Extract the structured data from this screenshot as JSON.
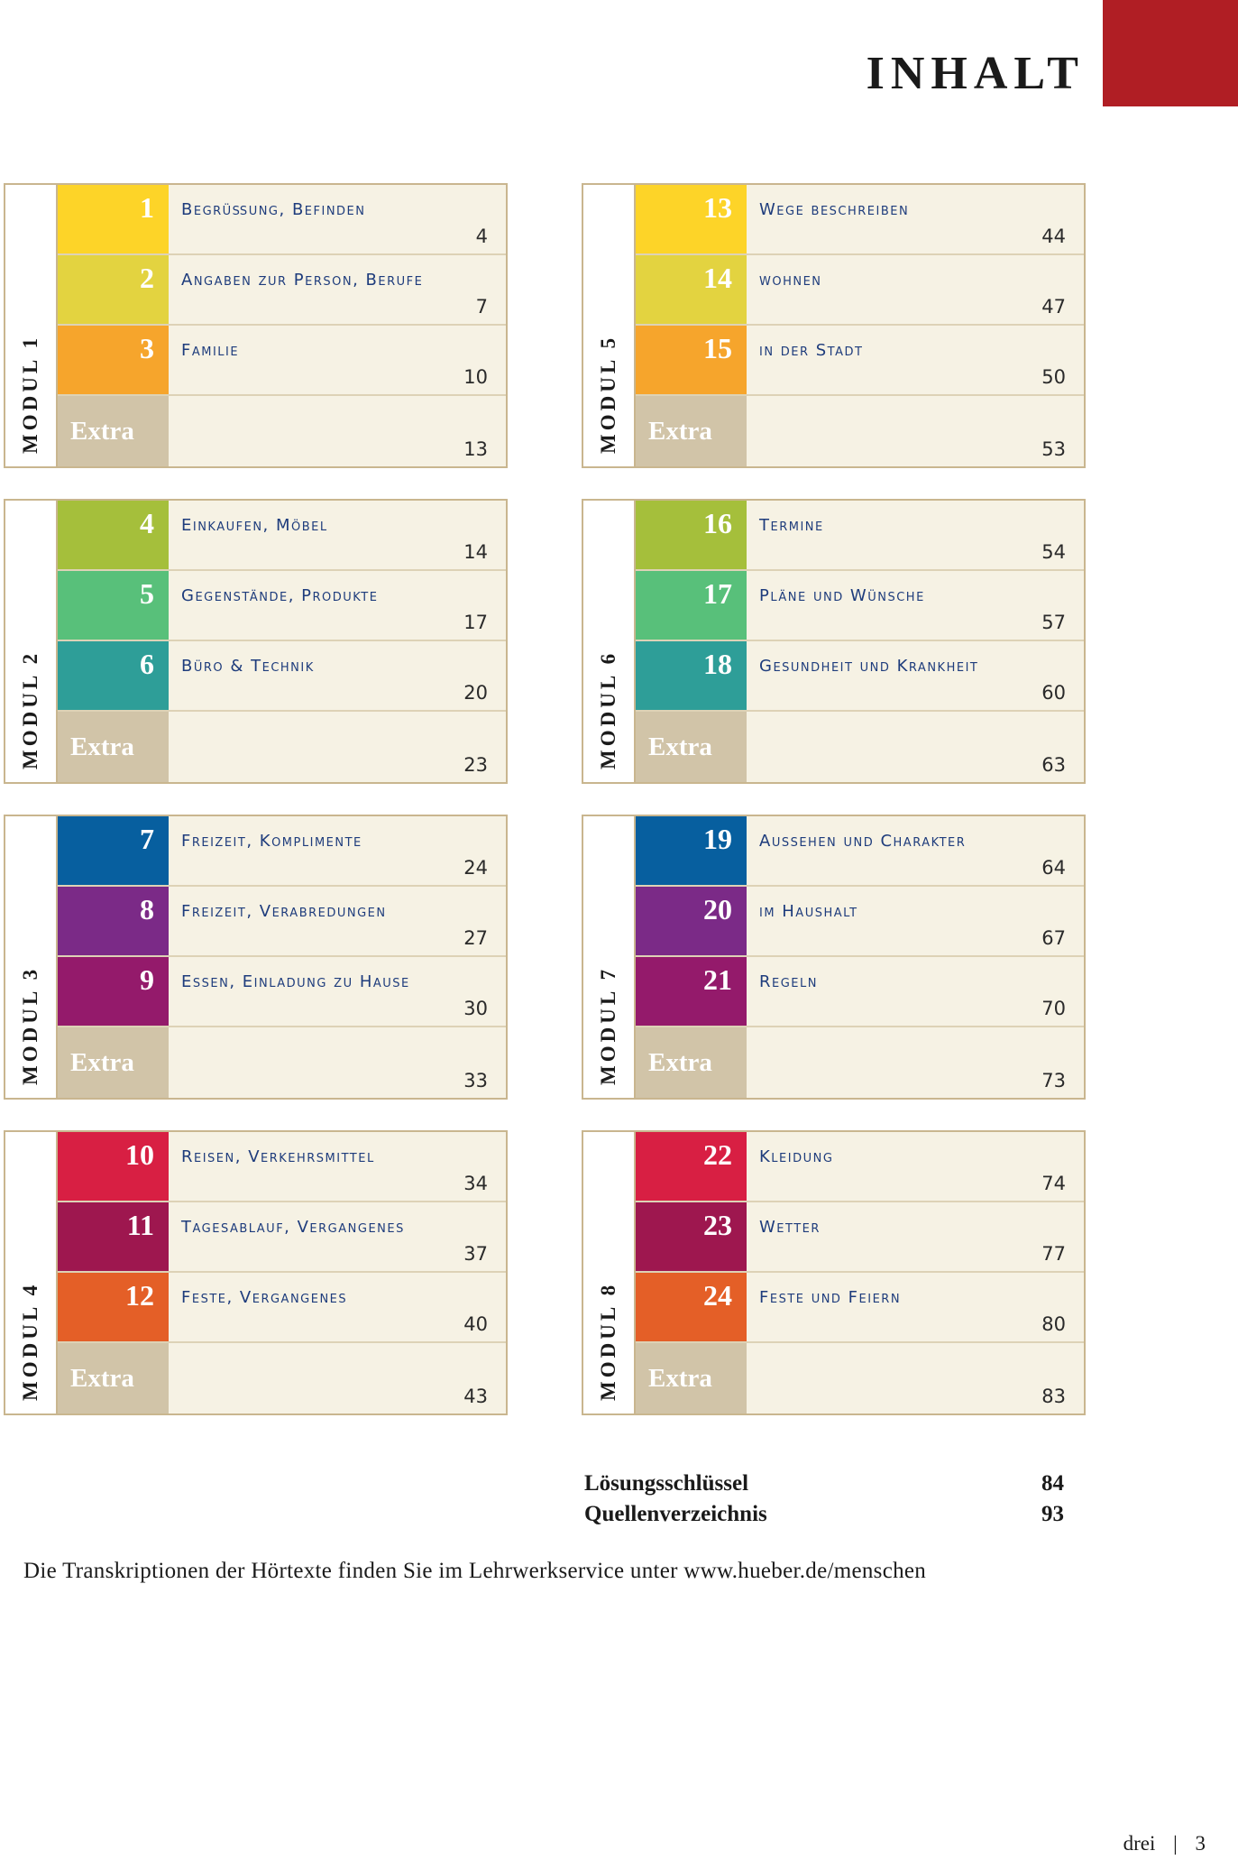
{
  "header": {
    "title": "INHALT",
    "accent_color": "#b01e24"
  },
  "colors": {
    "yellow": "#fdd428",
    "yellow2": "#e3d340",
    "orange": "#f6a52c",
    "lime": "#a5bf3b",
    "green": "#58c07a",
    "teal": "#2e9e98",
    "blue": "#075f9f",
    "purple": "#7b2a87",
    "plum": "#941a6b",
    "red": "#d81f43",
    "wine": "#9e174f",
    "deeporange": "#e45f27",
    "extra": "#d1c4a8",
    "border": "#c9b68f",
    "cell_bg": "#f6f2e4",
    "topic_text": "#1e3c7c"
  },
  "modules": [
    {
      "label": "MODUL 1",
      "rows": [
        {
          "num": "1",
          "topic": "Begrüßung, Befinden",
          "page": "4"
        },
        {
          "num": "2",
          "topic": "Angaben zur Person, Berufe",
          "page": "7"
        },
        {
          "num": "3",
          "topic": "Familie",
          "page": "10"
        },
        {
          "num": "Extra",
          "topic": "",
          "page": "13"
        }
      ]
    },
    {
      "label": "MODUL 2",
      "rows": [
        {
          "num": "4",
          "topic": "Einkaufen, Möbel",
          "page": "14"
        },
        {
          "num": "5",
          "topic": "Gegenstände, Produkte",
          "page": "17"
        },
        {
          "num": "6",
          "topic": "Büro & Technik",
          "page": "20"
        },
        {
          "num": "Extra",
          "topic": "",
          "page": "23"
        }
      ]
    },
    {
      "label": "MODUL 3",
      "rows": [
        {
          "num": "7",
          "topic": "Freizeit, Komplimente",
          "page": "24"
        },
        {
          "num": "8",
          "topic": "Freizeit, Verabredungen",
          "page": "27"
        },
        {
          "num": "9",
          "topic": "Essen, Einladung zu Hause",
          "page": "30"
        },
        {
          "num": "Extra",
          "topic": "",
          "page": "33"
        }
      ]
    },
    {
      "label": "MODUL 4",
      "rows": [
        {
          "num": "10",
          "topic": "Reisen, Verkehrsmittel",
          "page": "34"
        },
        {
          "num": "11",
          "topic": "Tagesablauf, Vergangenes",
          "page": "37"
        },
        {
          "num": "12",
          "topic": "Feste, Vergangenes",
          "page": "40"
        },
        {
          "num": "Extra",
          "topic": "",
          "page": "43"
        }
      ]
    },
    {
      "label": "MODUL 5",
      "rows": [
        {
          "num": "13",
          "topic": "Wege beschreiben",
          "page": "44"
        },
        {
          "num": "14",
          "topic": "wohnen",
          "page": "47"
        },
        {
          "num": "15",
          "topic": "in der Stadt",
          "page": "50"
        },
        {
          "num": "Extra",
          "topic": "",
          "page": "53"
        }
      ]
    },
    {
      "label": "MODUL 6",
      "rows": [
        {
          "num": "16",
          "topic": "Termine",
          "page": "54"
        },
        {
          "num": "17",
          "topic": "Pläne und Wünsche",
          "page": "57"
        },
        {
          "num": "18",
          "topic": "Gesundheit und Krankheit",
          "page": "60"
        },
        {
          "num": "Extra",
          "topic": "",
          "page": "63"
        }
      ]
    },
    {
      "label": "MODUL 7",
      "rows": [
        {
          "num": "19",
          "topic": "Aussehen und Charakter",
          "page": "64"
        },
        {
          "num": "20",
          "topic": "im Haushalt",
          "page": "67"
        },
        {
          "num": "21",
          "topic": "Regeln",
          "page": "70"
        },
        {
          "num": "Extra",
          "topic": "",
          "page": "73"
        }
      ]
    },
    {
      "label": "MODUL 8",
      "rows": [
        {
          "num": "22",
          "topic": "Kleidung",
          "page": "74"
        },
        {
          "num": "23",
          "topic": "Wetter",
          "page": "77"
        },
        {
          "num": "24",
          "topic": "Feste und Feiern",
          "page": "80"
        },
        {
          "num": "Extra",
          "topic": "",
          "page": "83"
        }
      ]
    }
  ],
  "extras": [
    {
      "label": "Lösungsschlüssel",
      "page": "84"
    },
    {
      "label": "Quellenverzeichnis",
      "page": "93"
    }
  ],
  "footnote": "Die Transkriptionen der Hörtexte finden Sie im Lehrwerkservice unter www.hueber.de/menschen",
  "folio": {
    "word": "drei",
    "separator": "|",
    "number": "3"
  }
}
